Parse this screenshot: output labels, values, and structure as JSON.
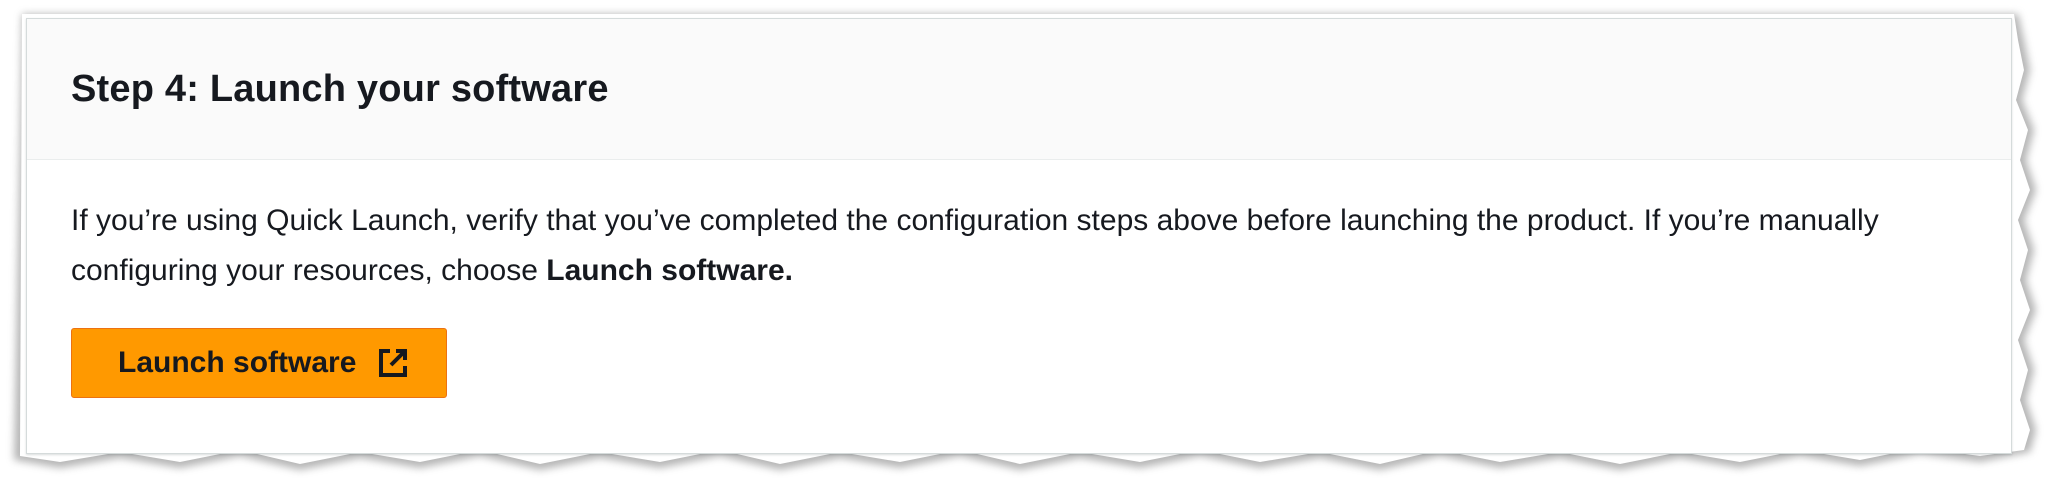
{
  "panel": {
    "title": "Step 4: Launch your software",
    "description_prefix": "If you’re using Quick Launch, verify that you’ve completed the configuration steps above before launching the product. If you’re manually configuring your resources, choose ",
    "description_bold": "Launch software.",
    "launch_button_label": "Launch software",
    "launch_button_icon": "external-link-icon"
  },
  "colors": {
    "button_bg": "#ff9900",
    "header_bg": "#fafafa",
    "text": "#16191f"
  }
}
